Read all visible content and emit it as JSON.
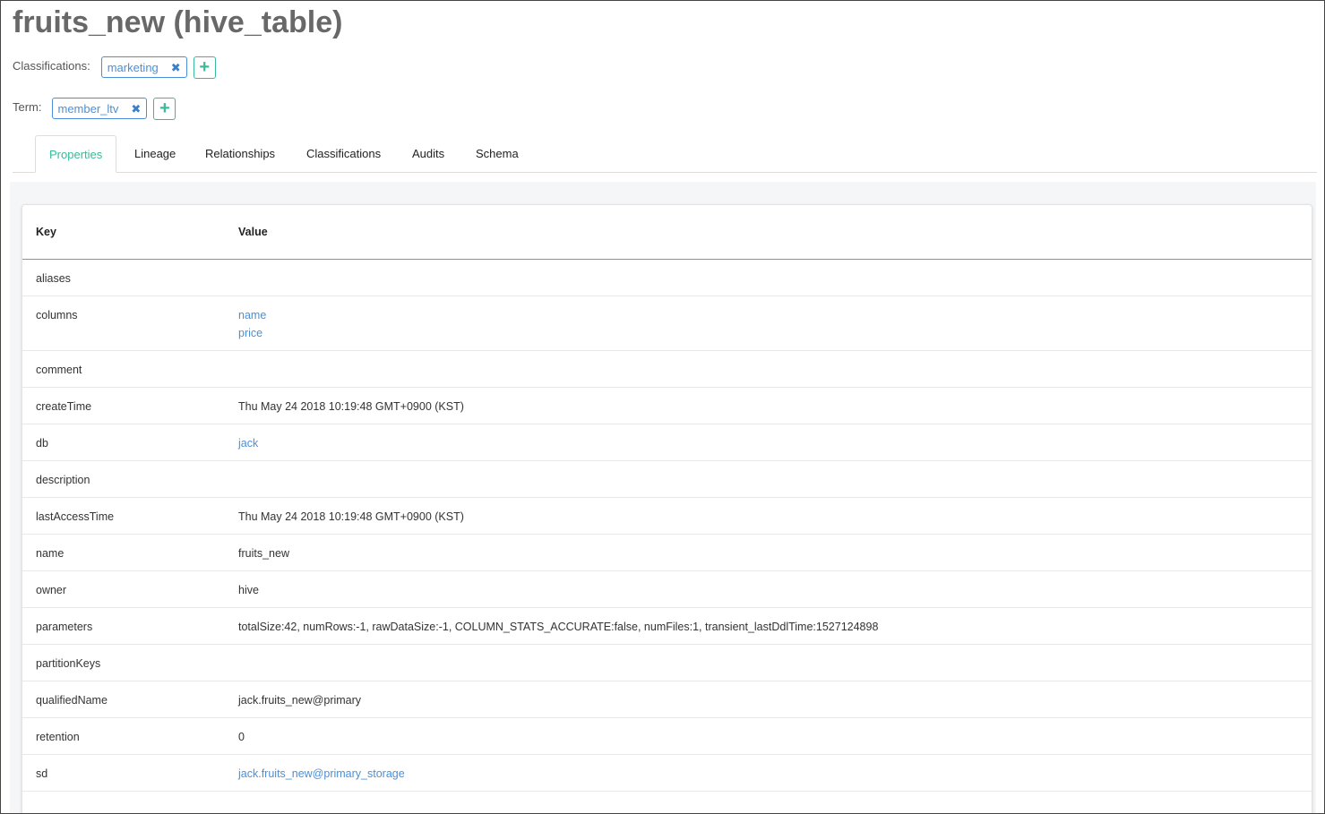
{
  "header": {
    "title": "fruits_new (hive_table)"
  },
  "classifications": {
    "label": "Classifications:",
    "tags": [
      "marketing"
    ]
  },
  "term": {
    "label": "Term:",
    "tags": [
      "member_ltv"
    ]
  },
  "tabs": [
    {
      "label": "Properties",
      "active": true
    },
    {
      "label": "Lineage",
      "active": false
    },
    {
      "label": "Relationships",
      "active": false
    },
    {
      "label": "Classifications",
      "active": false
    },
    {
      "label": "Audits",
      "active": false
    },
    {
      "label": "Schema",
      "active": false
    }
  ],
  "table": {
    "headers": {
      "key": "Key",
      "value": "Value"
    },
    "rows": [
      {
        "key": "aliases",
        "values": [],
        "link": false
      },
      {
        "key": "columns",
        "values": [
          "name",
          "price"
        ],
        "link": true
      },
      {
        "key": "comment",
        "values": [],
        "link": false
      },
      {
        "key": "createTime",
        "values": [
          "Thu May 24 2018 10:19:48 GMT+0900 (KST)"
        ],
        "link": false
      },
      {
        "key": "db",
        "values": [
          "jack"
        ],
        "link": true
      },
      {
        "key": "description",
        "values": [],
        "link": false
      },
      {
        "key": "lastAccessTime",
        "values": [
          "Thu May 24 2018 10:19:48 GMT+0900 (KST)"
        ],
        "link": false
      },
      {
        "key": "name",
        "values": [
          "fruits_new"
        ],
        "link": false
      },
      {
        "key": "owner",
        "values": [
          "hive"
        ],
        "link": false
      },
      {
        "key": "parameters",
        "values": [
          "totalSize:42, numRows:-1, rawDataSize:-1, COLUMN_STATS_ACCURATE:false, numFiles:1, transient_lastDdlTime:1527124898"
        ],
        "link": false
      },
      {
        "key": "partitionKeys",
        "values": [],
        "link": false
      },
      {
        "key": "qualifiedName",
        "values": [
          "jack.fruits_new@primary"
        ],
        "link": false
      },
      {
        "key": "retention",
        "values": [
          "0"
        ],
        "link": false
      },
      {
        "key": "sd",
        "values": [
          "jack.fruits_new@primary_storage"
        ],
        "link": true
      }
    ]
  },
  "colors": {
    "accent": "#37bb9b",
    "link": "#4a90d9",
    "title": "#686868"
  },
  "icons": {
    "remove_tag": "close-icon",
    "add": "plus-icon"
  }
}
